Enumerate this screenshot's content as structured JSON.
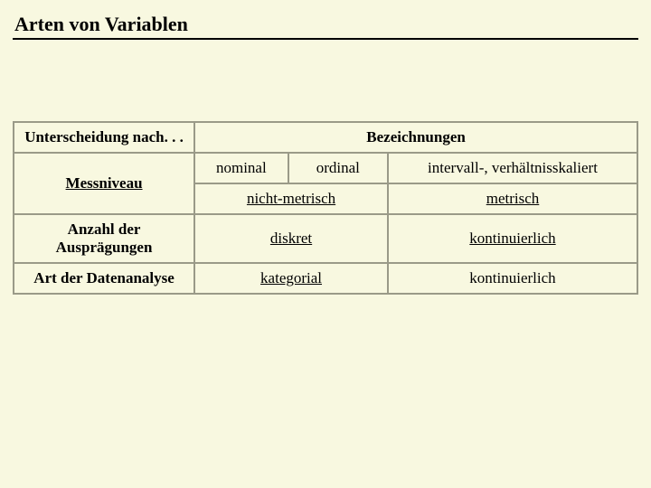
{
  "title": "Arten von Variablen",
  "table": {
    "header": {
      "left": "Unterscheidung nach. . .",
      "right": "Bezeichnungen"
    },
    "messniveau": {
      "label": "Messniveau",
      "row1": {
        "c1": "nominal",
        "c2": "ordinal",
        "c3": "intervall-, verhältnisskaliert"
      },
      "row2": {
        "c12": "nicht-metrisch",
        "c3": "metrisch"
      }
    },
    "anzahl": {
      "label": "Anzahl der Ausprägungen",
      "c12": "diskret",
      "c3": "kontinuierlich"
    },
    "art": {
      "label": "Art der Datenanalyse",
      "c12": "kategorial",
      "c3": "kontinuierlich"
    }
  }
}
